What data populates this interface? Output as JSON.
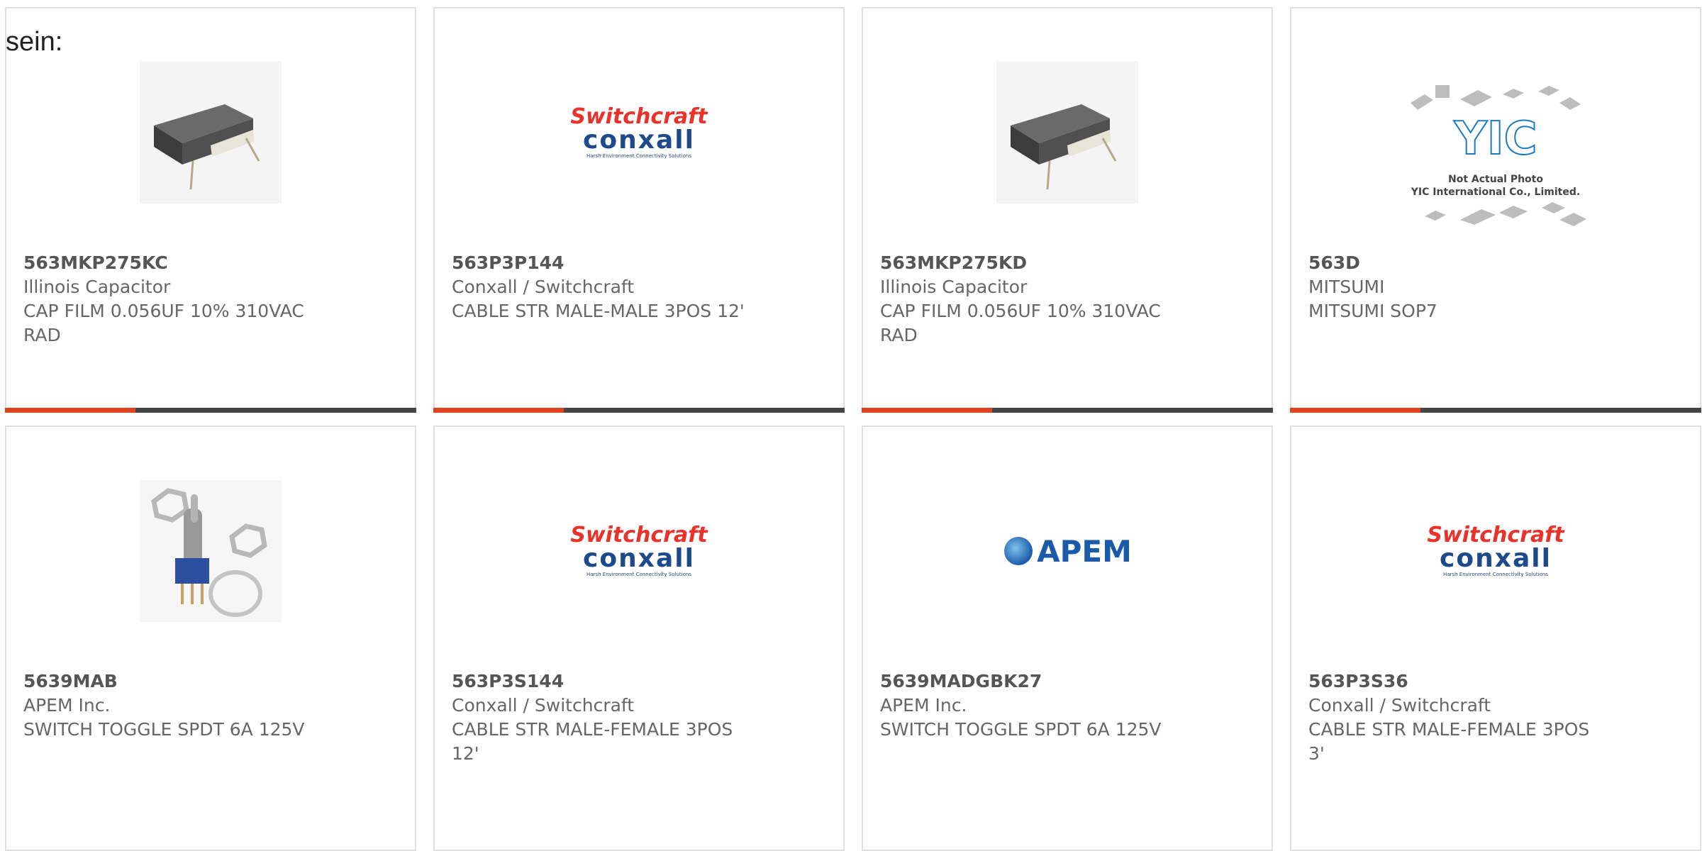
{
  "intro_text": "sein:",
  "products": [
    {
      "part": "563MKP275KC",
      "manufacturer": "Illinois Capacitor",
      "description": "CAP FILM 0.056UF 10% 310VAC RAD",
      "image": "capacitor-photo"
    },
    {
      "part": "563P3P144",
      "manufacturer": "Conxall / Switchcraft",
      "description": "CABLE STR MALE-MALE 3POS 12'",
      "image": "switchcraft-conxall-logo"
    },
    {
      "part": "563MKP275KD",
      "manufacturer": "Illinois Capacitor",
      "description": "CAP FILM 0.056UF 10% 310VAC RAD",
      "image": "capacitor-photo"
    },
    {
      "part": "563D",
      "manufacturer": "MITSUMI",
      "description": "MITSUMI SOP7",
      "image": "yic-not-actual-photo"
    },
    {
      "part": "5639MAB",
      "manufacturer": "APEM Inc.",
      "description": "SWITCH TOGGLE SPDT 6A 125V",
      "image": "toggle-switch-photo"
    },
    {
      "part": "563P3S144",
      "manufacturer": "Conxall / Switchcraft",
      "description": "CABLE STR MALE-FEMALE 3POS 12'",
      "image": "switchcraft-conxall-logo"
    },
    {
      "part": "5639MADGBK27",
      "manufacturer": "APEM Inc.",
      "description": "SWITCH TOGGLE SPDT 6A 125V",
      "image": "apem-logo"
    },
    {
      "part": "563P3S36",
      "manufacturer": "Conxall / Switchcraft",
      "description": "CABLE STR MALE-FEMALE 3POS 3'",
      "image": "switchcraft-conxall-logo"
    }
  ],
  "logos": {
    "switchcraft": "Switchcraft",
    "conxall": "conxall",
    "conxall_tagline": "Harsh Environment Connectivity Solutions",
    "yic_mark": "YIC",
    "yic_caption1": "Not Actual Photo",
    "yic_caption2": "YIC International Co., Limited.",
    "apem": "APEM"
  },
  "colors": {
    "accent": "#e0421b",
    "bar": "#444444",
    "switchcraft_red": "#e8322a",
    "conxall_blue": "#1d4a8c",
    "apem_blue": "#1a5aa8"
  }
}
